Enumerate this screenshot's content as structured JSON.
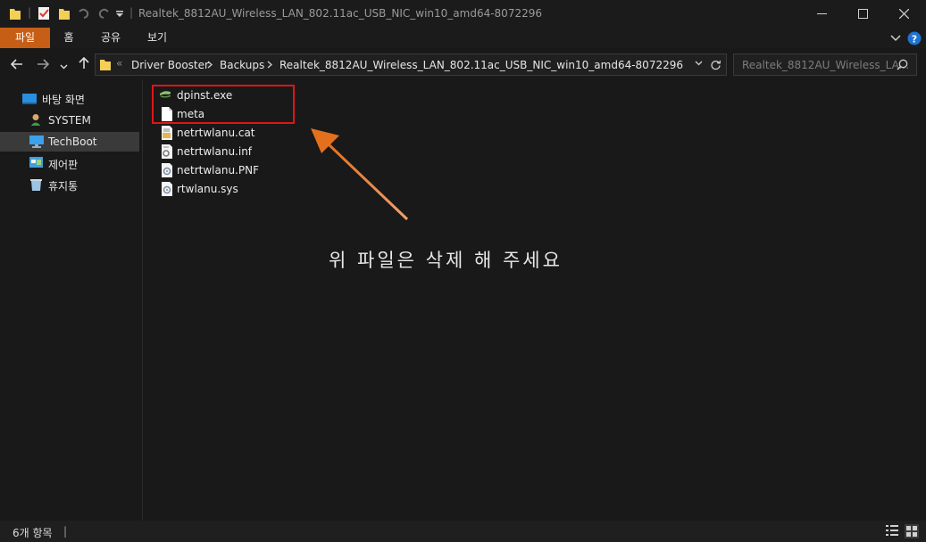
{
  "window": {
    "title": "Realtek_8812AU_Wireless_LAN_802.11ac_USB_NIC_win10_amd64-8072296",
    "qa_separator": "|"
  },
  "ribbon": {
    "tabs": [
      {
        "label": "파일",
        "active": true
      },
      {
        "label": "홈",
        "active": false
      },
      {
        "label": "공유",
        "active": false
      },
      {
        "label": "보기",
        "active": false
      }
    ]
  },
  "address": {
    "overflow": "«",
    "crumbs": [
      "Driver Booster",
      "Backups",
      "Realtek_8812AU_Wireless_LAN_802.11ac_USB_NIC_win10_amd64-8072296"
    ]
  },
  "search": {
    "placeholder": "Realtek_8812AU_Wireless_LA..."
  },
  "sidebar": {
    "items": [
      {
        "label": "바탕 화면",
        "icon": "desktop-icon"
      },
      {
        "label": "SYSTEM",
        "icon": "user-icon"
      },
      {
        "label": "TechBoot",
        "icon": "pc-icon",
        "selected": true
      },
      {
        "label": "제어판",
        "icon": "control-panel-icon"
      },
      {
        "label": "휴지통",
        "icon": "recycle-bin-icon"
      }
    ]
  },
  "files": [
    {
      "name": "dpinst.exe",
      "icon": "exe-icon"
    },
    {
      "name": "meta",
      "icon": "file-icon"
    },
    {
      "name": "netrtwlanu.cat",
      "icon": "catalog-icon"
    },
    {
      "name": "netrtwlanu.inf",
      "icon": "inf-icon"
    },
    {
      "name": "netrtwlanu.PNF",
      "icon": "settings-file-icon"
    },
    {
      "name": "rtwlanu.sys",
      "icon": "settings-file-icon"
    }
  ],
  "annotation": {
    "note": "위 파일은 삭제 해 주세요",
    "highlight_color": "#e01515",
    "arrow_color": "#e87a1e"
  },
  "status": {
    "count": "6개 항목",
    "separator": "|"
  },
  "colors": {
    "accent": "#c65e16",
    "help": "#1e73d1"
  }
}
